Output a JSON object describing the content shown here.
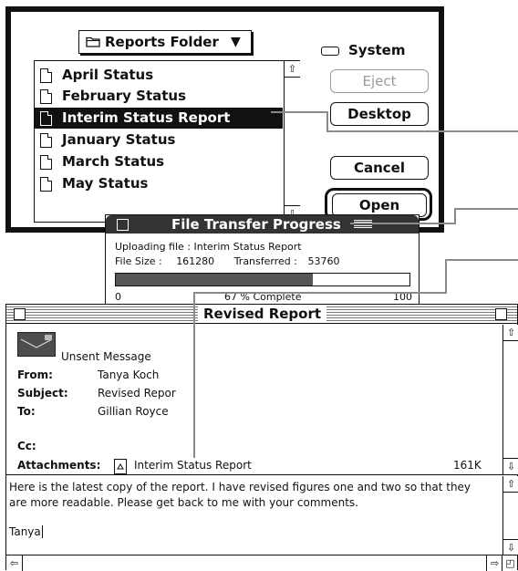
{
  "open_dialog": {
    "folder_popup_label": "Reports Folder",
    "popup_arrow": "▼",
    "files": [
      {
        "name": "April Status",
        "selected": false
      },
      {
        "name": "February Status",
        "selected": false
      },
      {
        "name": "Interim Status Report",
        "selected": true
      },
      {
        "name": "January Status",
        "selected": false
      },
      {
        "name": "March Status",
        "selected": false
      },
      {
        "name": "May Status",
        "selected": false
      }
    ],
    "disk_label": "System",
    "buttons": {
      "eject": "Eject",
      "desktop": "Desktop",
      "cancel": "Cancel",
      "open": "Open"
    }
  },
  "transfer": {
    "title": "File Transfer Progress",
    "uploading_label": "Uploading file :",
    "uploading_file": "Interim Status Report",
    "file_size_label": "File Size :",
    "file_size_value": "161280",
    "transferred_label": "Transferred :",
    "transferred_value": "53760",
    "progress_fraction": 0.67,
    "scale_start": "0",
    "percent_text": "67 % Complete",
    "scale_end": "100"
  },
  "message": {
    "window_title": "Revised Report",
    "status": "Unsent Message",
    "from_label": "From:",
    "from_value": "Tanya Koch",
    "subject_label": "Subject:",
    "subject_value": "Revised Repor",
    "to_label": "To:",
    "to_value": "Gillian Royce",
    "cc_label": "Cc:",
    "attachments_label": "Attachments:",
    "attachment_name": "Interim Status Report",
    "attachment_size": "161K",
    "body_line1": "Here is the latest copy of the report. I have revised figures one and two so that they",
    "body_line2": "are more readable. Please get back to me with your comments.",
    "signature": "Tanya"
  },
  "icons": [
    "folder-icon",
    "document-icon",
    "disk-icon",
    "envelope-icon",
    "attachment-icon"
  ]
}
